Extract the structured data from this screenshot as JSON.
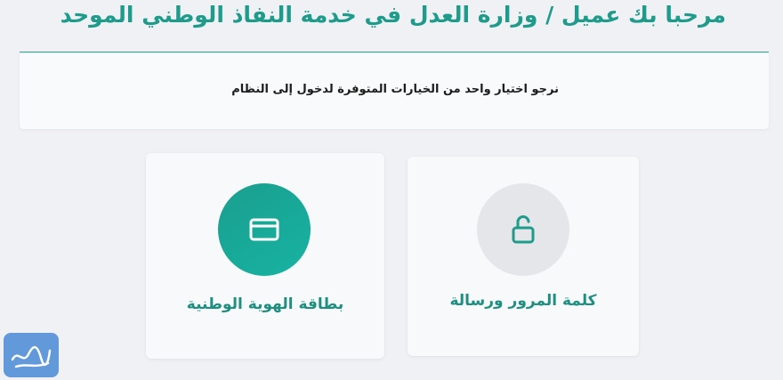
{
  "header": {
    "title": "مرحبا بك عميل / وزارة العدل في خدمة النفاذ الوطني الموحد"
  },
  "info": {
    "message": "نرجو اختيار واحد من الخيارات المتوفرة لدخول إلى النظام"
  },
  "options": {
    "password": {
      "label": "كلمة المرور ورسالة",
      "icon": "unlock-icon"
    },
    "national_id": {
      "label": "بطاقة الهوية الوطنية",
      "icon": "id-card-icon"
    }
  },
  "colors": {
    "accent": "#1f9b8c",
    "id_circle": "#17b3a3",
    "password_circle": "#e4e6ea"
  }
}
